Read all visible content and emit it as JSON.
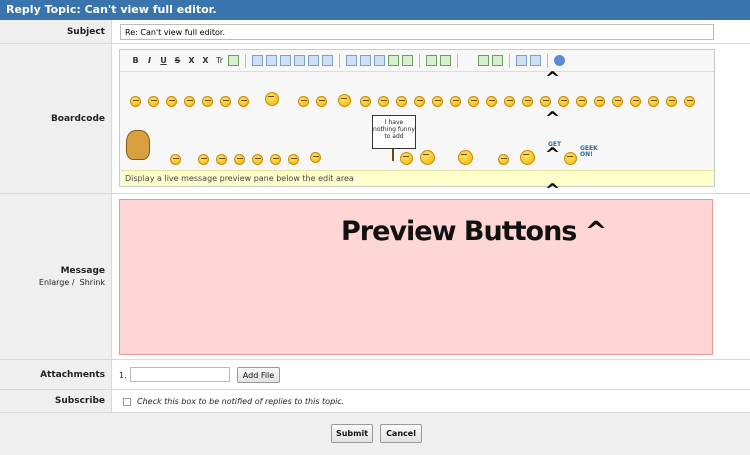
{
  "title": "Reply Topic: Can't view full editor.",
  "subject": {
    "label": "Subject",
    "value": "Re: Can't view full editor."
  },
  "boardcode": {
    "label": "Boardcode",
    "toolbar_buttons": [
      "B",
      "I",
      "U",
      "S",
      "X",
      "X",
      "Tr"
    ],
    "sign_text": "I have nothing funny to add",
    "get_text_1": "GET",
    "get_text_2": "GEEK ON!",
    "preview_hint": "Display a live message preview pane below the edit area"
  },
  "message": {
    "label": "Message",
    "enlarge": "Enlarge",
    "shrink": "Shrink"
  },
  "attachments": {
    "label": "Attachments",
    "index": "1.",
    "add_file": "Add File"
  },
  "subscribe": {
    "label": "Subscribe",
    "text": "Check this box to be notified of replies to this topic."
  },
  "actions": {
    "submit": "Submit",
    "cancel": "Cancel"
  },
  "annotation": {
    "text": "Preview Buttons ^",
    "caret": "^"
  }
}
